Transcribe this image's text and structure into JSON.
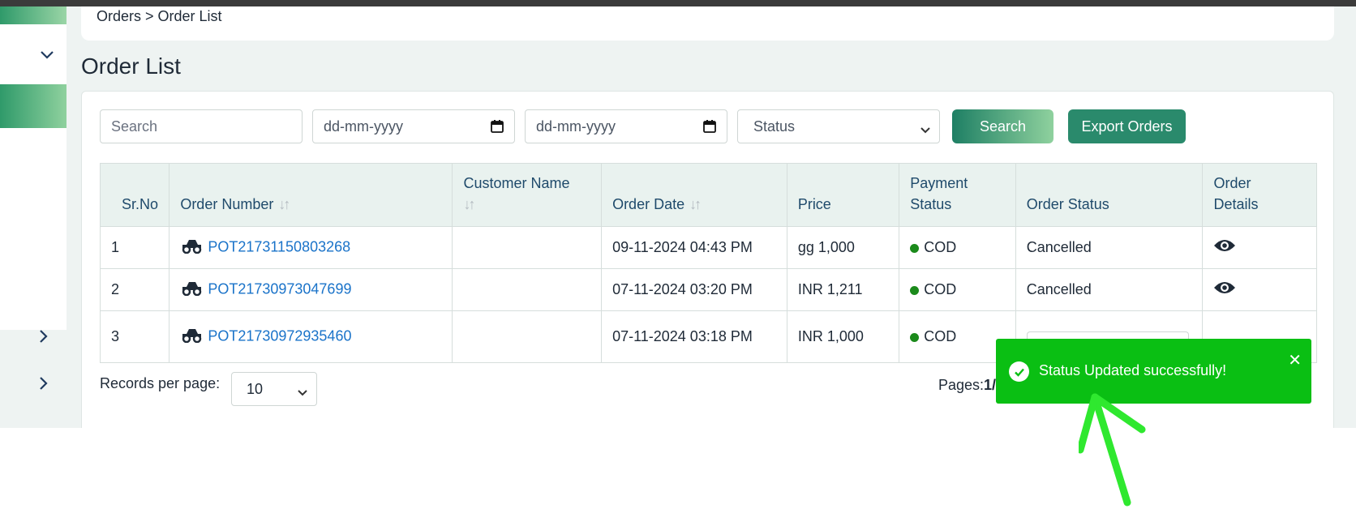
{
  "breadcrumb": {
    "text": "Orders > Order List"
  },
  "page": {
    "title": "Order List"
  },
  "filters": {
    "search_placeholder": "Search",
    "from_date_placeholder": "dd-mm-yyyy",
    "to_date_placeholder": "dd-mm-yyyy",
    "status_selected": "Status",
    "search_button": "Search",
    "export_button": "Export Orders"
  },
  "table": {
    "headers": {
      "sr": "Sr.No",
      "order_number": "Order Number",
      "customer_name": "Customer Name",
      "order_date": "Order Date",
      "price": "Price",
      "payment_status": "Payment Status",
      "order_status": "Order Status",
      "order_details": "Order Details"
    },
    "rows": [
      {
        "sr": "1",
        "order_number": "POT21731150803268",
        "customer_name": "",
        "order_date": "09-11-2024 04:43 PM",
        "price": "gg 1,000",
        "payment": "COD",
        "status": "Cancelled"
      },
      {
        "sr": "2",
        "order_number": "POT21730973047699",
        "customer_name": "",
        "order_date": "07-11-2024 03:20 PM",
        "price": "INR 1,211",
        "payment": "COD",
        "status": "Cancelled"
      },
      {
        "sr": "3",
        "order_number": "POT21730972935460",
        "customer_name": "",
        "order_date": "07-11-2024 03:18 PM",
        "price": "INR 1,000",
        "payment": "COD",
        "status": ""
      }
    ]
  },
  "pagination": {
    "records_label": "Records per page:",
    "records_value": "10",
    "pages_label": "Pages:",
    "pages_value": "1/"
  },
  "toast": {
    "message": "Status Updated successfully!"
  },
  "colors": {
    "accent": "#2a8a6c",
    "toast": "#0abf13",
    "link": "#1a73c9",
    "cod_dot": "#1b8a1b"
  },
  "icons": {
    "row_vehicle": "truck-icon",
    "view": "eye-icon",
    "toast_ok": "check-circle-icon",
    "toast_close": "close-icon"
  }
}
